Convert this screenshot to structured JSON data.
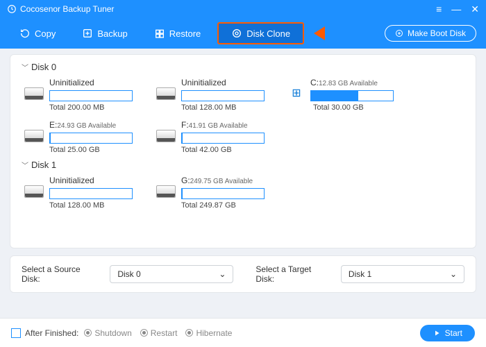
{
  "app": {
    "title": "Cocosenor Backup Tuner"
  },
  "toolbar": {
    "copy": "Copy",
    "backup": "Backup",
    "restore": "Restore",
    "disk_clone": "Disk Clone",
    "boot_disk": "Make Boot Disk"
  },
  "disks": {
    "disk0": {
      "label": "Disk 0",
      "p0": {
        "title": "Uninitialized",
        "avail": "",
        "total": "Total 200.00 MB",
        "fill": 0
      },
      "p1": {
        "title": "Uninitialized",
        "avail": "",
        "total": "Total 128.00 MB",
        "fill": 0
      },
      "p2": {
        "title": "C:",
        "avail": "12.83 GB Available",
        "total": "Total 30.00 GB",
        "fill": 58
      },
      "p3": {
        "title": "E:",
        "avail": "24.93 GB Available",
        "total": "Total 25.00 GB",
        "fill": 1
      },
      "p4": {
        "title": "F:",
        "avail": "41.91 GB Available",
        "total": "Total 42.00 GB",
        "fill": 1
      }
    },
    "disk1": {
      "label": "Disk 1",
      "p0": {
        "title": "Uninitialized",
        "avail": "",
        "total": "Total 128.00 MB",
        "fill": 0
      },
      "p1": {
        "title": "G:",
        "avail": "249.75 GB Available",
        "total": "Total 249.87 GB",
        "fill": 1
      }
    }
  },
  "selectors": {
    "source_label": "Select a Source Disk:",
    "source_value": "Disk 0",
    "target_label": "Select a Target Disk:",
    "target_value": "Disk 1"
  },
  "footer": {
    "after_label": "After Finished:",
    "shutdown": "Shutdown",
    "restart": "Restart",
    "hibernate": "Hibernate",
    "start": "Start"
  }
}
